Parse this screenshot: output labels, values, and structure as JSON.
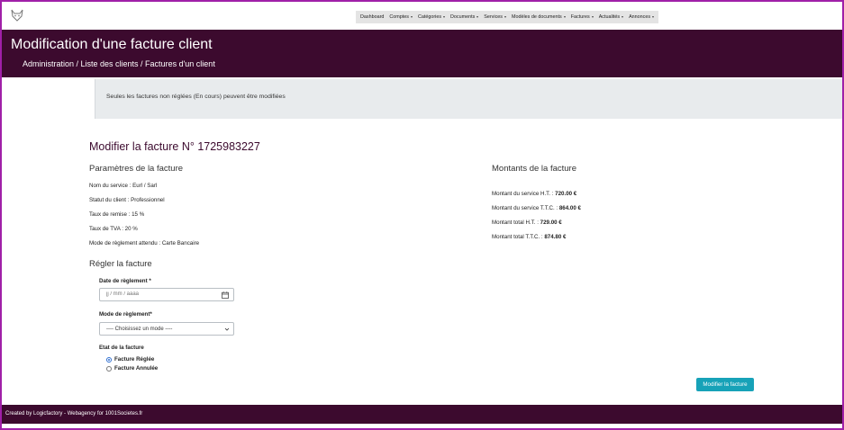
{
  "nav": {
    "items": [
      {
        "label": "Dashboard",
        "caret": false
      },
      {
        "label": "Comptes",
        "caret": true
      },
      {
        "label": "Catégories",
        "caret": true
      },
      {
        "label": "Documents",
        "caret": true
      },
      {
        "label": "Services",
        "caret": true
      },
      {
        "label": "Modèles de documents",
        "caret": true
      },
      {
        "label": "Factures",
        "caret": true
      },
      {
        "label": "Actualités",
        "caret": true
      },
      {
        "label": "Annonces",
        "caret": true
      }
    ]
  },
  "header": {
    "title": "Modification d'une facture client",
    "breadcrumb": "Administration / Liste des clients / Factures d'un client"
  },
  "notice": "Seules les factures non réglées (En cours) peuvent être modifiées",
  "invoice": {
    "heading": "Modifier la facture N° 1725983227",
    "params_heading": "Paramètres de la facture",
    "params": [
      "Nom du service : Eurl / Sarl",
      "Statut du client : Professionnel",
      "Taux de remise : 15 %",
      "Taux de TVA : 20 %",
      "Mode de règlement attendu : Carte Bancaire"
    ],
    "amounts_heading": "Montants de la facture",
    "amounts": [
      {
        "label": "Montant du service H.T. : ",
        "value": "720.00 €"
      },
      {
        "label": "Montant du service T.T.C. : ",
        "value": "864.00 €"
      },
      {
        "label": "Montant total H.T. : ",
        "value": "729.00 €"
      },
      {
        "label": "Montant total T.T.C. : ",
        "value": "874.80 €"
      }
    ]
  },
  "form": {
    "heading": "Régler la facture",
    "date_label": "Date de règlement *",
    "date_placeholder": "jj / mm / aaaa",
    "mode_label": "Mode de règlement*",
    "mode_selected": "---- Choisissez un mode ----",
    "state_label": "Etat de la facture",
    "state_options": [
      {
        "label": "Facture Réglée",
        "checked": true
      },
      {
        "label": "Facture Annulée",
        "checked": false
      }
    ],
    "submit_label": "Modifier la facture"
  },
  "footer": "Created by Logicfactory - Webagency for 1001Societes.fr",
  "colors": {
    "brand": "#3c0a2e",
    "button": "#17a2b8",
    "notice_bg": "#e8ebed",
    "frame": "#a020a8"
  }
}
